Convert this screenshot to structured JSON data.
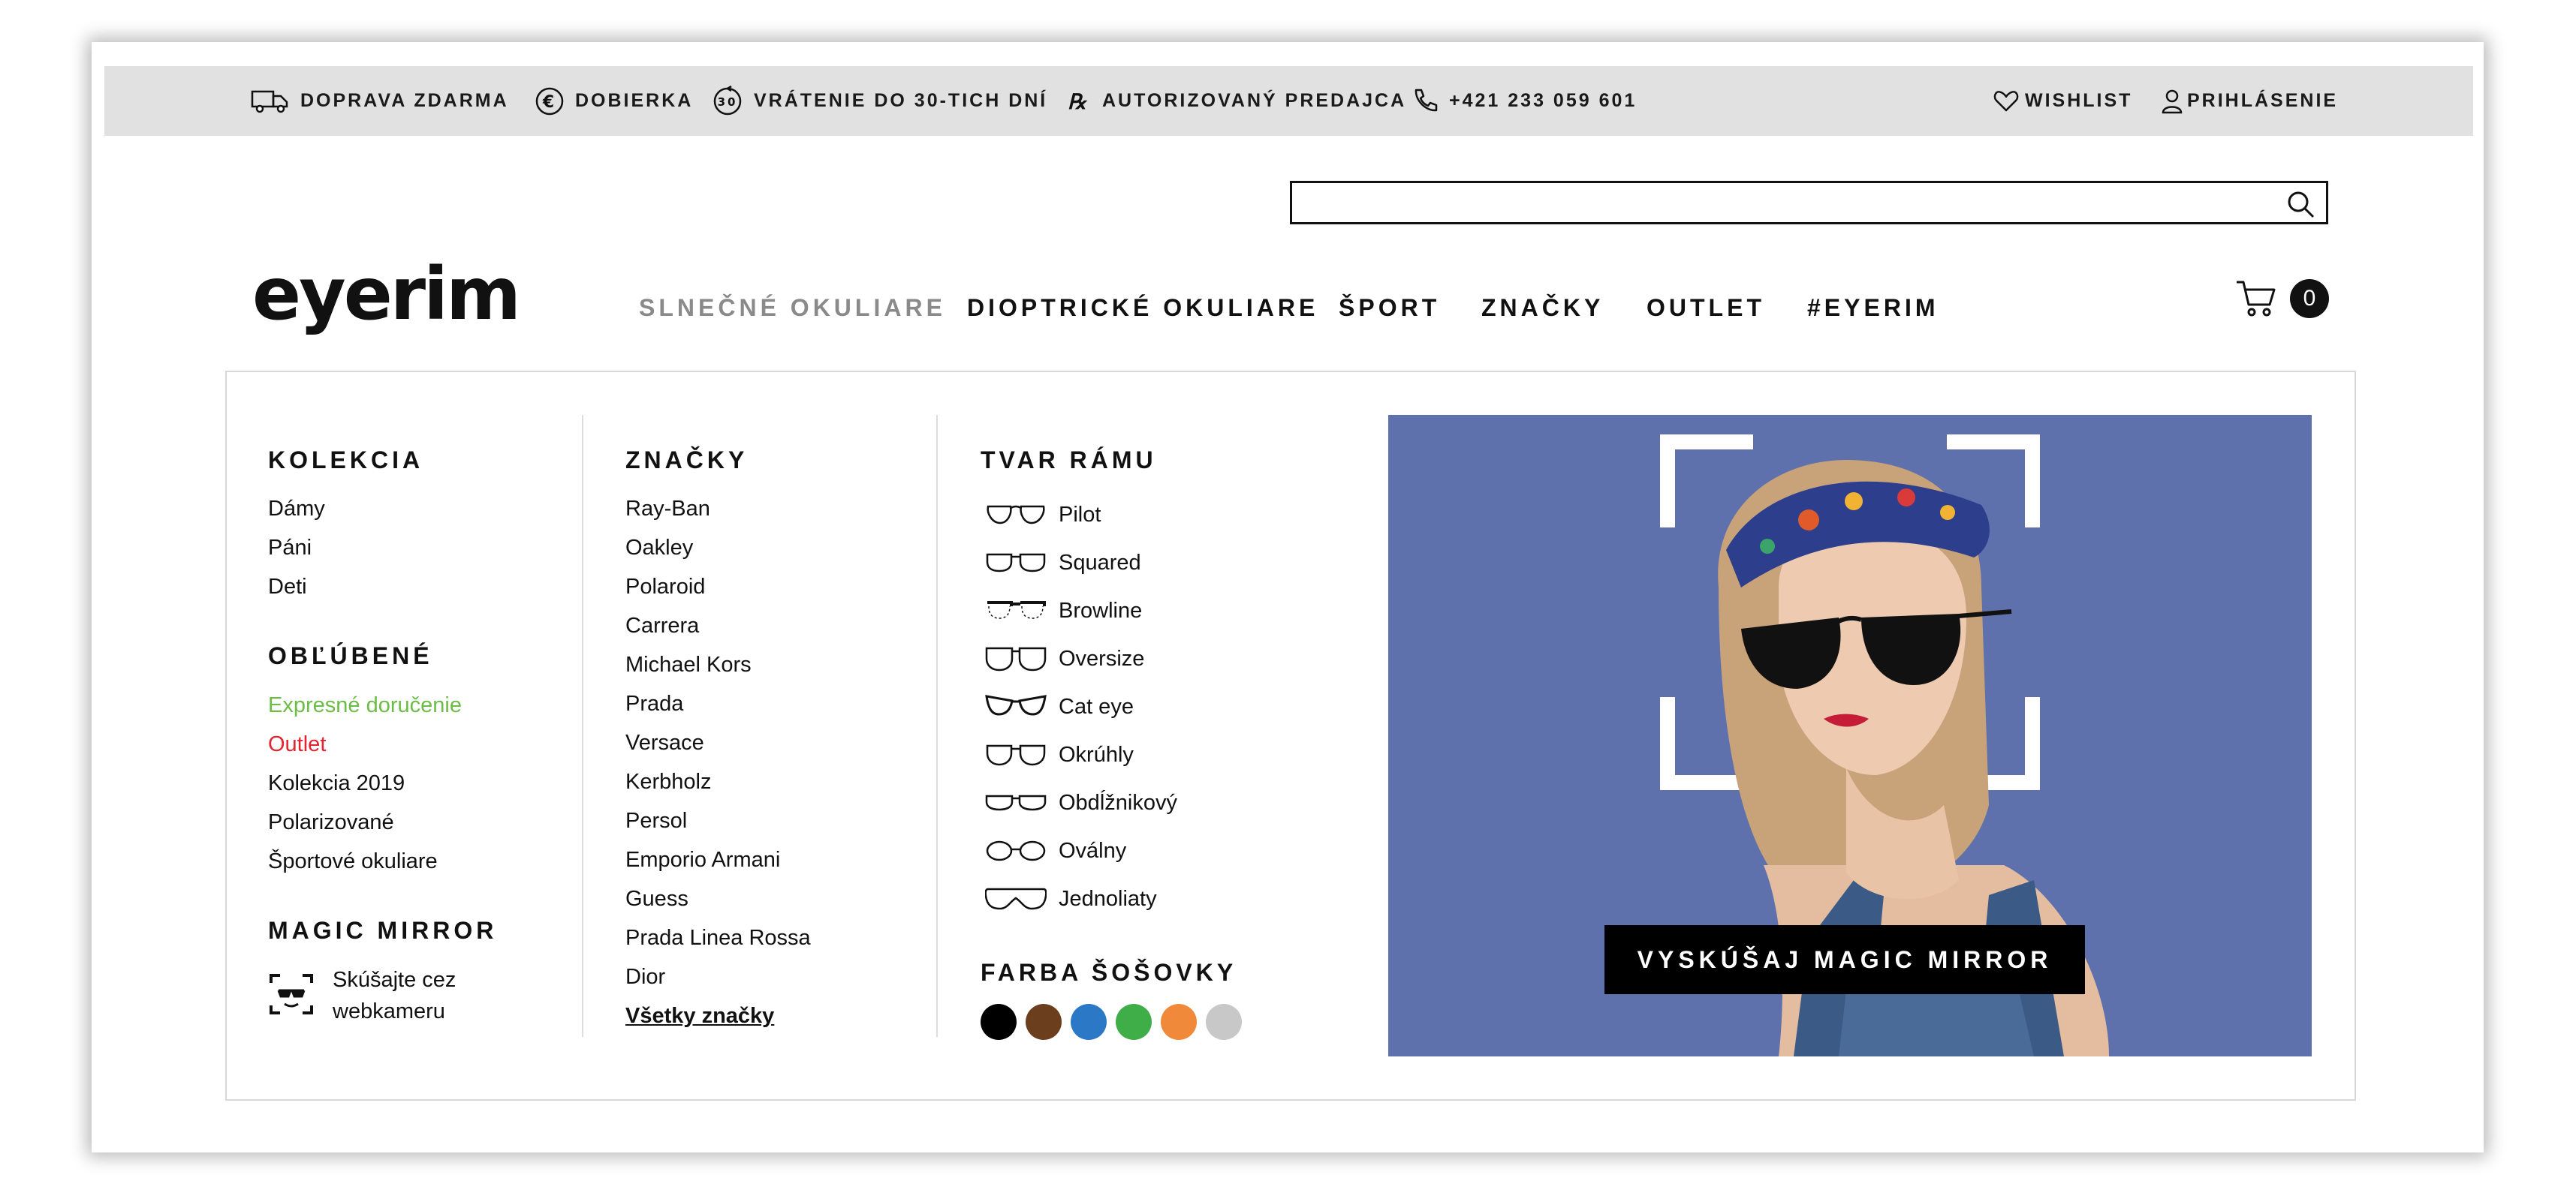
{
  "topbar": {
    "free_shipping": "DOPRAVA ZDARMA",
    "cod": "DOBIERKA",
    "returns": "VRÁTENIE DO 30-TICH DNÍ",
    "returns_badge": "30",
    "authorized": "AUTORIZOVANÝ PREDAJCA",
    "phone": "+421 233 059 601",
    "wishlist": "WISHLIST",
    "login": "PRIHLÁSENIE"
  },
  "search": {
    "placeholder": ""
  },
  "logo": {
    "text": "eyerim"
  },
  "nav": {
    "items": [
      "SLNEČNÉ OKULIARE",
      "DIOPTRICKÉ OKULIARE",
      "ŠPORT",
      "ZNAČKY",
      "OUTLET",
      "#EYERIM"
    ],
    "active_index": 0
  },
  "cart": {
    "count": "0"
  },
  "menu": {
    "kolekcia": {
      "heading": "KOLEKCIA",
      "items": [
        "Dámy",
        "Páni",
        "Deti"
      ]
    },
    "oblubene": {
      "heading": "OBĽÚBENÉ",
      "items": [
        "Expresné doručenie",
        "Outlet",
        "Kolekcia 2019",
        "Polarizované",
        "Športové okuliare"
      ],
      "colors": {
        "Expresné doručenie": "#6bbd45",
        "Outlet": "#e3232f"
      }
    },
    "magic_mirror": {
      "heading": "MAGIC MIRROR",
      "text_line1": "Skúšajte cez",
      "text_line2": "webkameru",
      "icon": "webcam-face-icon"
    },
    "znacky": {
      "heading": "ZNAČKY",
      "items": [
        "Ray-Ban",
        "Oakley",
        "Polaroid",
        "Carrera",
        "Michael Kors",
        "Prada",
        "Versace",
        "Kerbholz",
        "Persol",
        "Emporio Armani",
        "Guess",
        "Prada Linea Rossa",
        "Dior"
      ],
      "all_brands": "Všetky značky"
    },
    "tvar_ramu": {
      "heading": "TVAR RÁMU",
      "items": [
        "Pilot",
        "Squared",
        "Browline",
        "Oversize",
        "Cat eye",
        "Okrúhly",
        "Obdĺžnikový",
        "Oválny",
        "Jednoliaty"
      ]
    },
    "farba_sosovky": {
      "heading": "FARBA ŠOŠOVKY",
      "swatches": [
        "#000000",
        "#6b3e1e",
        "#2a78c6",
        "#3fae49",
        "#f0893a",
        "#c8c8c8"
      ]
    },
    "promo": {
      "button_label": "VYSKÚŠAJ MAGIC MIRROR",
      "background": "#5f71ac"
    }
  }
}
